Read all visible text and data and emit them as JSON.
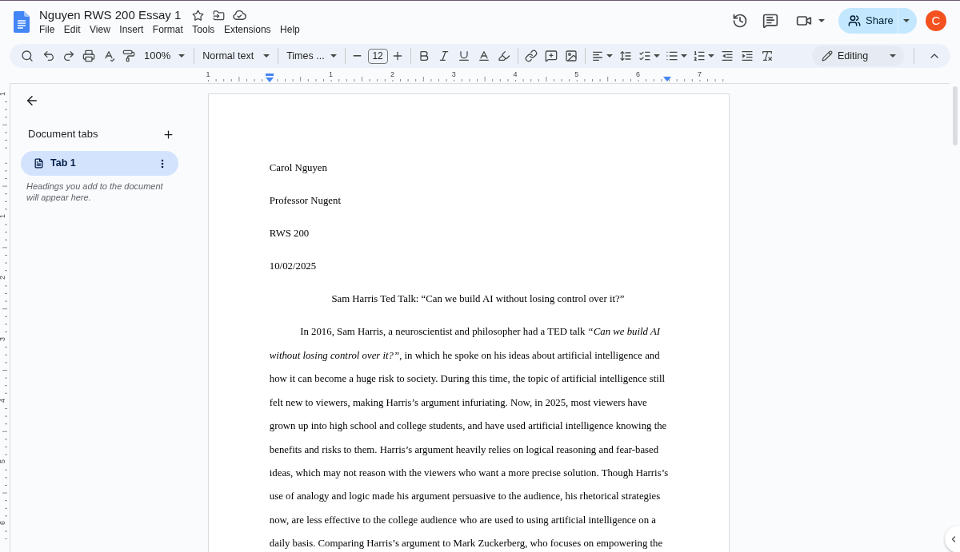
{
  "header": {
    "doc_title": "Nguyen RWS 200 Essay 1",
    "menu": [
      "File",
      "Edit",
      "View",
      "Insert",
      "Format",
      "Tools",
      "Extensions",
      "Help"
    ],
    "share_label": "Share",
    "avatar_initial": "C"
  },
  "toolbar": {
    "zoom": "100%",
    "paragraph_style": "Normal text",
    "font": "Times ...",
    "font_size": "12",
    "mode": "Editing"
  },
  "ruler": {
    "labels": [
      "1",
      "1",
      "2",
      "3",
      "4",
      "5",
      "6",
      "7"
    ]
  },
  "vertical_ruler": {
    "labels": [
      "1",
      "1",
      "2",
      "3",
      "4",
      "5",
      "6"
    ]
  },
  "tabs_panel": {
    "title": "Document tabs",
    "tabs": [
      {
        "label": "Tab 1",
        "selected": true
      }
    ],
    "hint": "Headings you add to the document will appear here."
  },
  "page": {
    "header_lines": [
      "Carol Nguyen",
      "Professor Nugent",
      "RWS 200",
      "10/02/2025"
    ],
    "title": "Sam Harris Ted Talk: “Can we build AI without losing control over it?”",
    "paragraphs": [
      "In 2016, Sam Harris, a neuroscientist and philosopher had a TED talk *“Can we build AI without losing control over it?”*, in which he spoke on his ideas about artificial intelligence and how it can become a huge risk to society. During this time, the topic of artificial intelligence still felt new to viewers, making Harris’s argument infuriating. Now, in 2025, most viewers have grown up into high school and college students, and have used artificial intelligence knowing the benefits and risks to them. Harris’s argument heavily relies on logical reasoning and fear-based ideas, which may not reason with the viewers who want a more precise solution. Though Harris’s use of analogy and logic made his argument persuasive to the audience, his rhetorical strategies now, are less effective to the college audience who are used to using artificial intelligence on a daily basis. Comparing Harris’s argument to Mark Zuckerberg, who focuses on empowering the"
    ]
  }
}
